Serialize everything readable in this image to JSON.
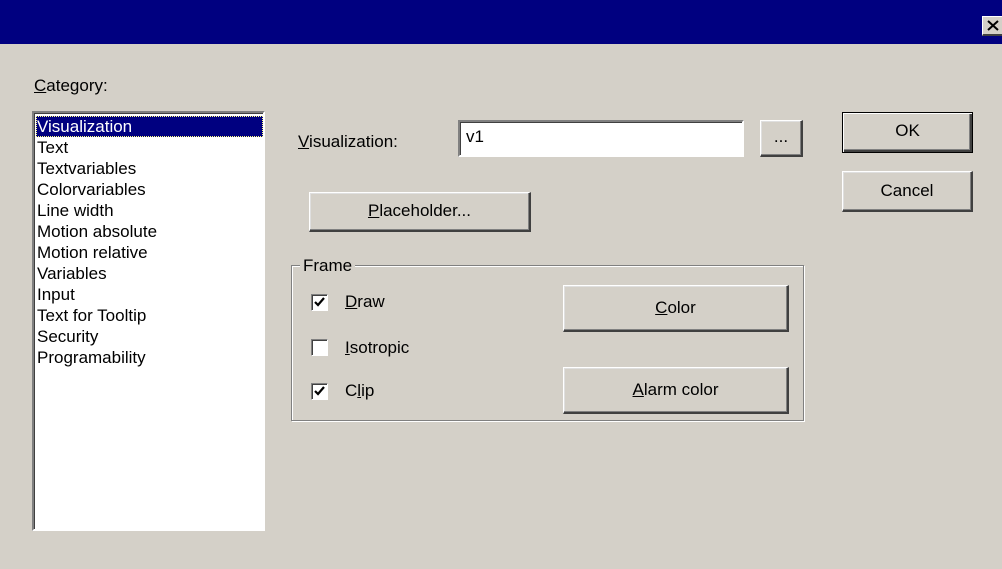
{
  "dialog": {
    "category_label": "Category:",
    "categories": [
      "Visualization",
      "Text",
      "Textvariables",
      "Colorvariables",
      "Line width",
      "Motion absolute",
      "Motion relative",
      "Variables",
      "Input",
      "Text for Tooltip",
      "Security",
      "Programability"
    ],
    "selected_category": "Visualization",
    "visualization_label": "Visualization:",
    "visualization_value": "v1",
    "browse_label": "...",
    "placeholder_label": "Placeholder...",
    "ok_label": "OK",
    "cancel_label": "Cancel",
    "frame": {
      "title": "Frame",
      "draw_label": "Draw",
      "draw_checked": true,
      "isotropic_label": "Isotropic",
      "isotropic_checked": false,
      "clip_label": "Clip",
      "clip_checked": true,
      "color_label": "Color",
      "alarm_color_label": "Alarm color"
    }
  },
  "icons": {
    "close": "close-icon",
    "check": "checkmark-icon"
  },
  "colors": {
    "titlebar": "#000080",
    "face": "#d4d0c8",
    "selection": "#000080"
  }
}
